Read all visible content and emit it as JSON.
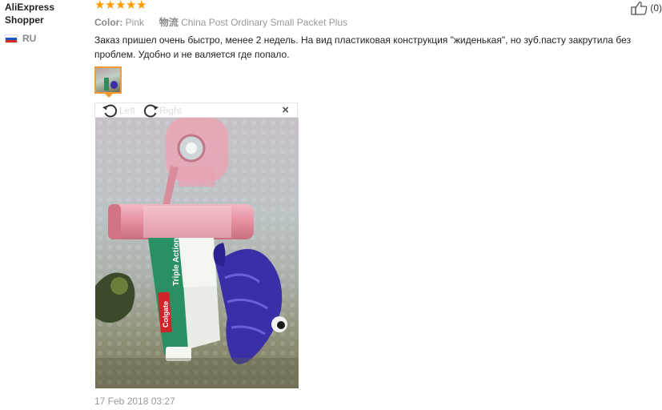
{
  "user": {
    "name": "AliExpress Shopper",
    "country": "RU"
  },
  "rating": {
    "stars": 5
  },
  "attributes": {
    "color_label": "Color:",
    "color_value": "Pink",
    "shipping_label": "物流",
    "shipping_value": "China Post Ordinary Small Packet Plus"
  },
  "review_text": "Заказ пришел очень быстро, менее 2 недель. На вид пластиковая конструкция \"жиденькая\", но зуб.пасту закрутила без проблем. Удобно и не валяется где попало.",
  "helpful": {
    "count": "(0)",
    "icon": "thumbs-up-icon"
  },
  "viewer": {
    "rotate_left": "Left",
    "rotate_right": "Right",
    "close": "×"
  },
  "photo": {
    "tube_brand": "Colgate",
    "tube_product": "Triple Action"
  },
  "timestamp": "17 Feb 2018 03:27",
  "colors": {
    "star": "#ff9a00",
    "thumb_border": "#f59a2f"
  }
}
